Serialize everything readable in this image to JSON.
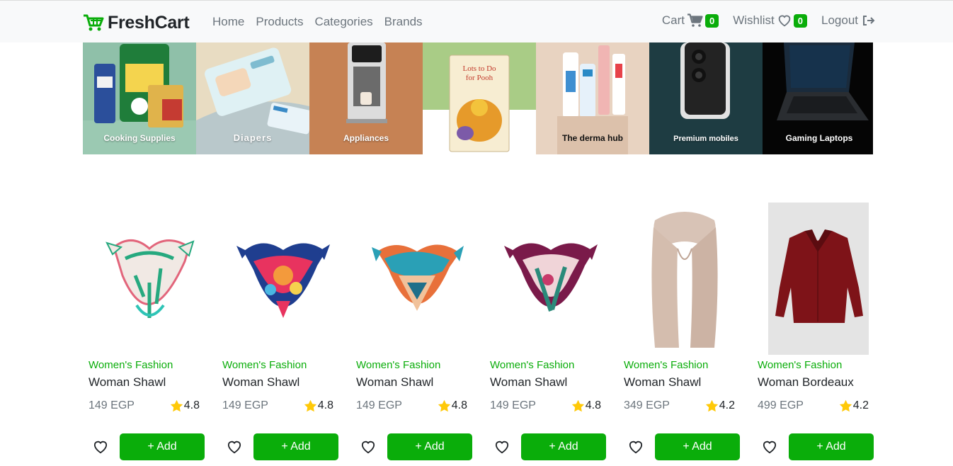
{
  "brand": {
    "name": "FreshCart"
  },
  "nav": {
    "links": [
      "Home",
      "Products",
      "Categories",
      "Brands"
    ],
    "cart_label": "Cart",
    "cart_count": "0",
    "wishlist_label": "Wishlist",
    "wishlist_count": "0",
    "logout_label": "Logout"
  },
  "categories": [
    {
      "label": "Cooking Supplies",
      "bg": "#8fc0a9"
    },
    {
      "label": "Diapers",
      "bg": "#b9c8cb"
    },
    {
      "label": "Appliances",
      "bg": "#c68254"
    },
    {
      "label": "",
      "bg": "#a9cc86"
    },
    {
      "label": "The derma hub",
      "bg": "#e8d3c1"
    },
    {
      "label": "Premium mobiles",
      "bg": "#1e3c42"
    },
    {
      "label": "Gaming Laptops",
      "bg": "#050505"
    }
  ],
  "products": [
    {
      "category": "Women's Fashion",
      "title": "Woman Shawl",
      "price": "149 EGP",
      "rating": "4.8",
      "add_label": "+ Add",
      "colors": [
        "#f1e9e4",
        "#26a97f",
        "#e2657b"
      ]
    },
    {
      "category": "Women's Fashion",
      "title": "Woman Shawl",
      "price": "149 EGP",
      "rating": "4.8",
      "add_label": "+ Add",
      "colors": [
        "#1f3e8f",
        "#e8335f",
        "#f39a3c"
      ]
    },
    {
      "category": "Women's Fashion",
      "title": "Woman Shawl",
      "price": "149 EGP",
      "rating": "4.8",
      "add_label": "+ Add",
      "colors": [
        "#e8703a",
        "#2aa0b6",
        "#f1c29b"
      ]
    },
    {
      "category": "Women's Fashion",
      "title": "Woman Shawl",
      "price": "149 EGP",
      "rating": "4.8",
      "add_label": "+ Add",
      "colors": [
        "#7a1a4a",
        "#f0d4d8",
        "#2a8a7a"
      ]
    },
    {
      "category": "Women's Fashion",
      "title": "Woman Shawl",
      "price": "349 EGP",
      "rating": "4.2",
      "add_label": "+ Add",
      "colors": [
        "#d8c3b6",
        "#c9b1a3",
        "#e6d6cc"
      ]
    },
    {
      "category": "Women's Fashion",
      "title": "Woman Bordeaux",
      "price": "499 EGP",
      "rating": "4.2",
      "add_label": "+ Add",
      "colors": [
        "#7e1318",
        "#e4e4e4",
        "#5b0c10"
      ]
    }
  ],
  "colors": {
    "accent": "#0aad0a",
    "star": "#ffc908"
  }
}
